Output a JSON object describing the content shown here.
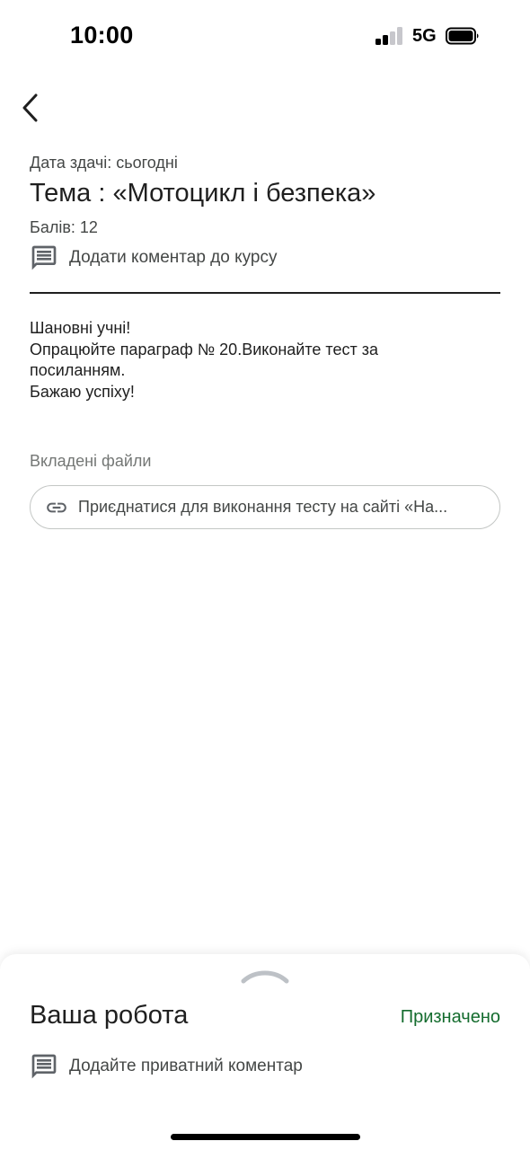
{
  "status_bar": {
    "time": "10:00",
    "network": "5G",
    "signal_bars_active": 2,
    "signal_bars_total": 4,
    "battery_icon": "battery-full-icon"
  },
  "nav": {
    "back_icon": "chevron-left-icon"
  },
  "assignment": {
    "due": "Дата здачі: сьогодні",
    "title": "Тема : «Мотоцикл і безпека»",
    "points": "Балів: 12",
    "class_comment_label": "Додати коментар до курсу",
    "class_comment_icon": "comment-icon",
    "instructions": [
      "Шановні учні!",
      "Опрацюйте параграф № 20.Виконайте тест за",
      "посиланням.",
      "Бажаю успіху!"
    ],
    "attachments_heading": "Вкладені файли",
    "attachments": [
      {
        "icon": "link-icon",
        "label": "Приєднатися для виконання тесту на сайті «На..."
      }
    ]
  },
  "your_work": {
    "title": "Ваша робота",
    "status": "Призначено",
    "private_comment_label": "Додайте приватний коментар",
    "private_comment_icon": "comment-icon",
    "handle_icon": "chevron-up-icon"
  },
  "colors": {
    "text_primary": "#1f1f1f",
    "text_secondary": "#444746",
    "text_hint": "#747775",
    "status_green": "#146c2e",
    "chip_border": "#c4c7c5",
    "icon_gray": "#5f6368"
  }
}
